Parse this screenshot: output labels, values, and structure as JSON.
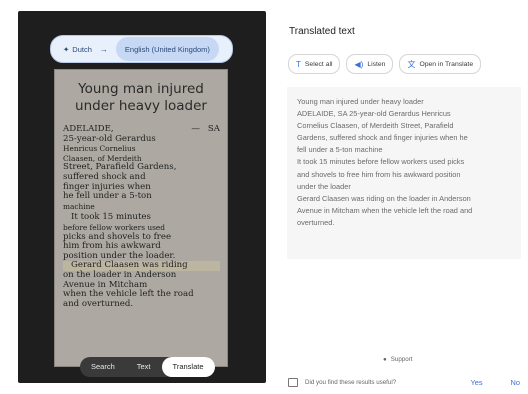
{
  "language_bar": {
    "source_icon": "sparkle-icon",
    "source": "Dutch",
    "arrow": "→",
    "target": "English (United Kingdom)"
  },
  "article": {
    "headline_line1": "Young man injured",
    "headline_line2": "under heavy loader",
    "dateline_left": "ADELAIDE,",
    "dateline_dash": "—",
    "dateline_right": "SA",
    "lines": [
      "25-year-old Gerardus",
      "Henricus Cornelius",
      "Claasen, of Merdeith",
      "Street, Parafield Gardens,",
      "suffered shock and",
      "finger injuries when",
      "he fell under a 5-ton",
      "machine",
      "It took 15 minutes",
      "before fellow workers used",
      "picks and shovels to free",
      "him from his awkward",
      "position under the loader.",
      "Gerard Claasen was riding",
      "on the loader in Anderson",
      "Avenue in Mitcham",
      "when the vehicle left the road",
      "and overturned."
    ]
  },
  "modes": {
    "search": "Search",
    "text": "Text",
    "translate": "Translate"
  },
  "panel": {
    "title": "Translated text",
    "select_all": "Select all",
    "listen": "Listen",
    "open_in_translate": "Open in Translate",
    "translation": [
      "Young man injured under heavy loader",
      "ADELAIDE, SA 25-year-old Gerardus Henricus",
      "Cornelius Claasen, of Merdeith Street, Parafield",
      "Gardens, suffered shock and finger injuries when he",
      "fell under a 5-ton machine",
      "It took 15 minutes before fellow workers used picks",
      "and shovels to free him from his awkward position",
      "under the loader",
      "Gerard Claasen was riding on the loader in Anderson",
      "Avenue in Mitcham when the vehicle left the road and",
      "overturned."
    ],
    "support": "Support",
    "feedback_question": "Did you find these results useful?",
    "yes": "Yes",
    "no": "No"
  },
  "colors": {
    "accent": "#3a6fd8",
    "pill_bg": "#e8f0fb",
    "dark_panel": "#1e1e1e"
  }
}
